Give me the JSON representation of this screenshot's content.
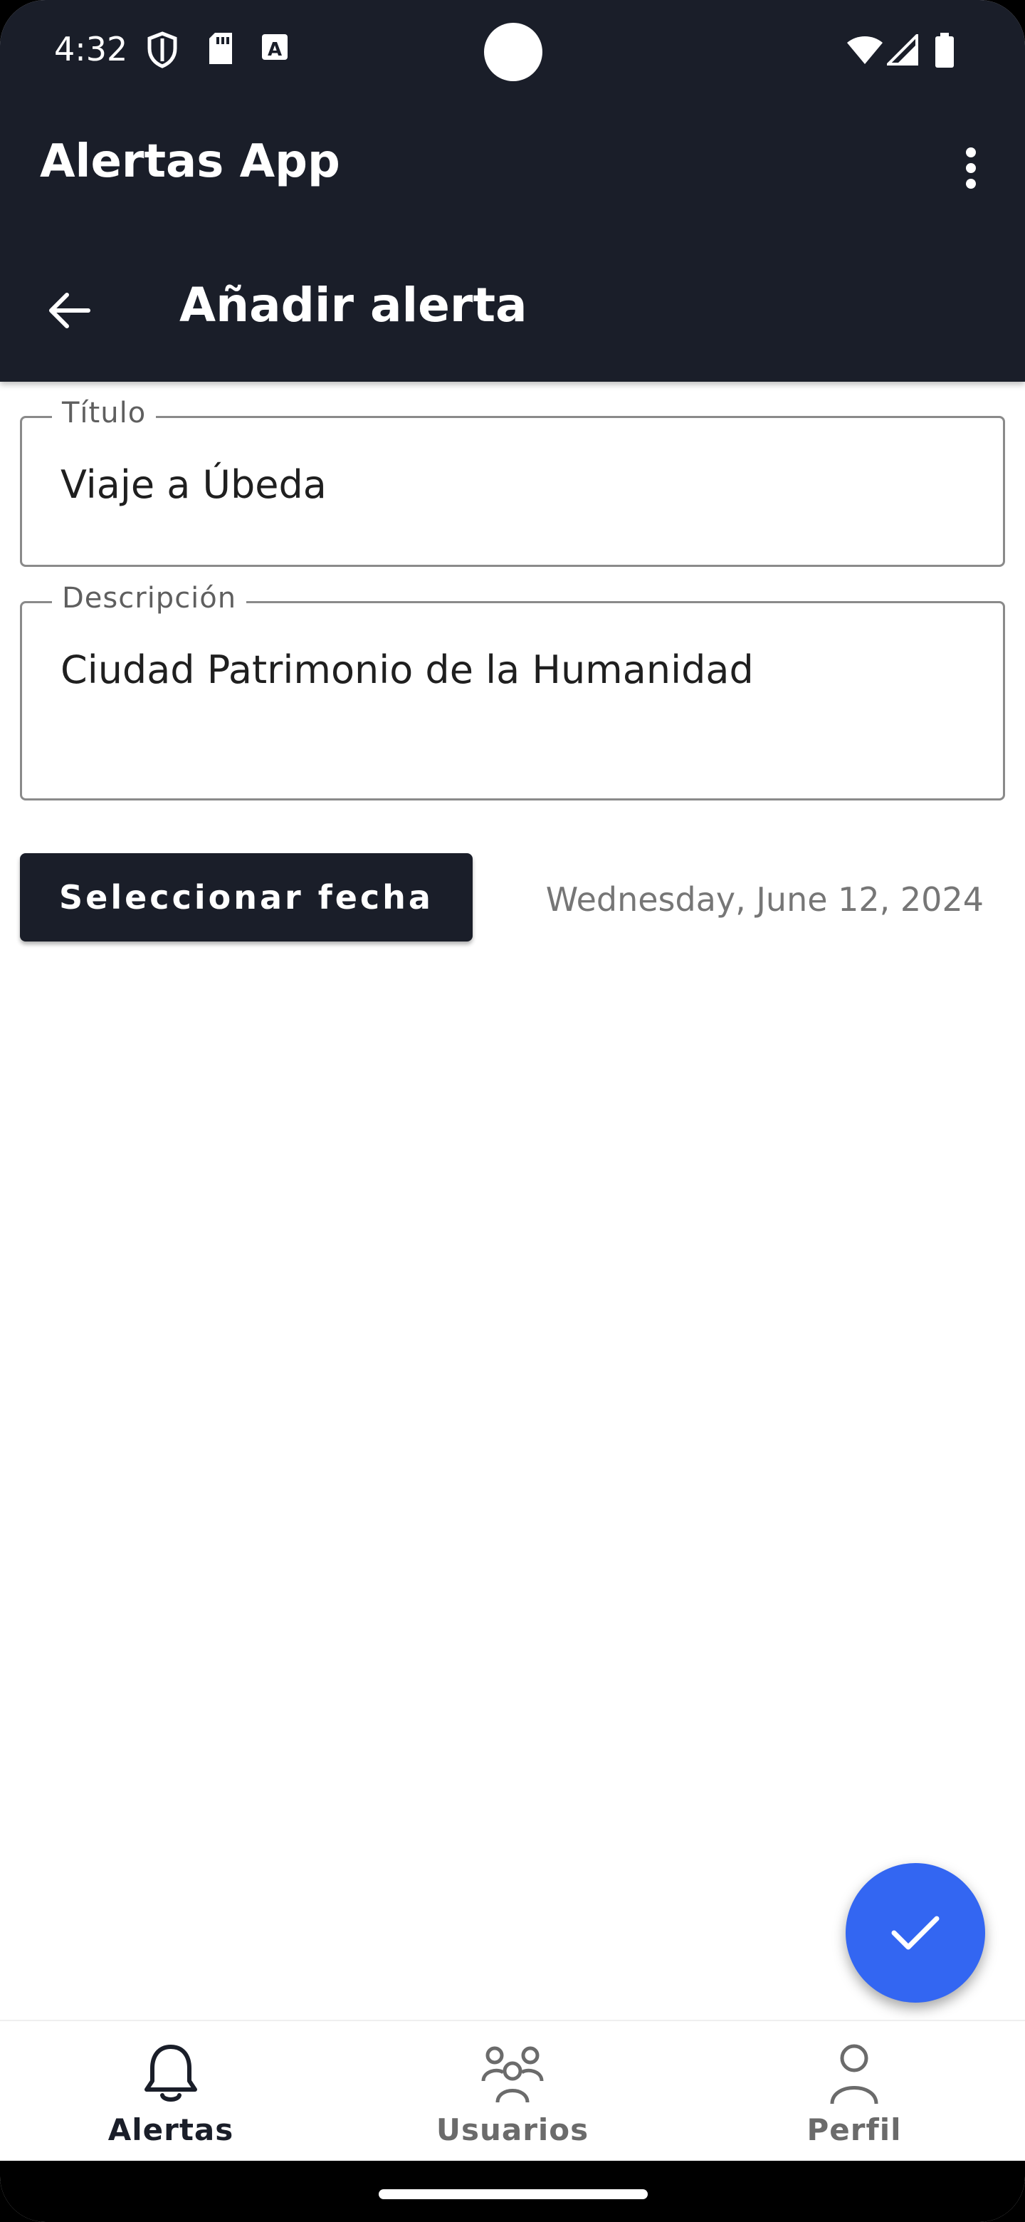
{
  "status_bar": {
    "time": "4:32",
    "icons": [
      "shield-icon",
      "sd-card-icon",
      "font-icon",
      "wifi-icon",
      "signal-icon",
      "battery-icon"
    ]
  },
  "app_bar": {
    "title": "Alertas App",
    "menu_icon": "more-vert-icon"
  },
  "sub_bar": {
    "back_icon": "arrow-back-icon",
    "title": "Añadir alerta"
  },
  "form": {
    "title_field": {
      "label": "Título",
      "value": "Viaje a Úbeda"
    },
    "description_field": {
      "label": "Descripción",
      "value": "Ciudad Patrimonio de la Humanidad"
    },
    "date_button_label": "Seleccionar fecha",
    "selected_date": "Wednesday, June 12, 2024"
  },
  "fab": {
    "icon": "check-icon"
  },
  "bottom_nav": {
    "items": [
      {
        "label": "Alertas",
        "icon": "bell-icon",
        "active": true
      },
      {
        "label": "Usuarios",
        "icon": "users-icon",
        "active": false
      },
      {
        "label": "Perfil",
        "icon": "person-icon",
        "active": false
      }
    ]
  },
  "colors": {
    "header_bg": "#1a1e29",
    "accent": "#3366f2",
    "border": "#8a8a8a"
  }
}
